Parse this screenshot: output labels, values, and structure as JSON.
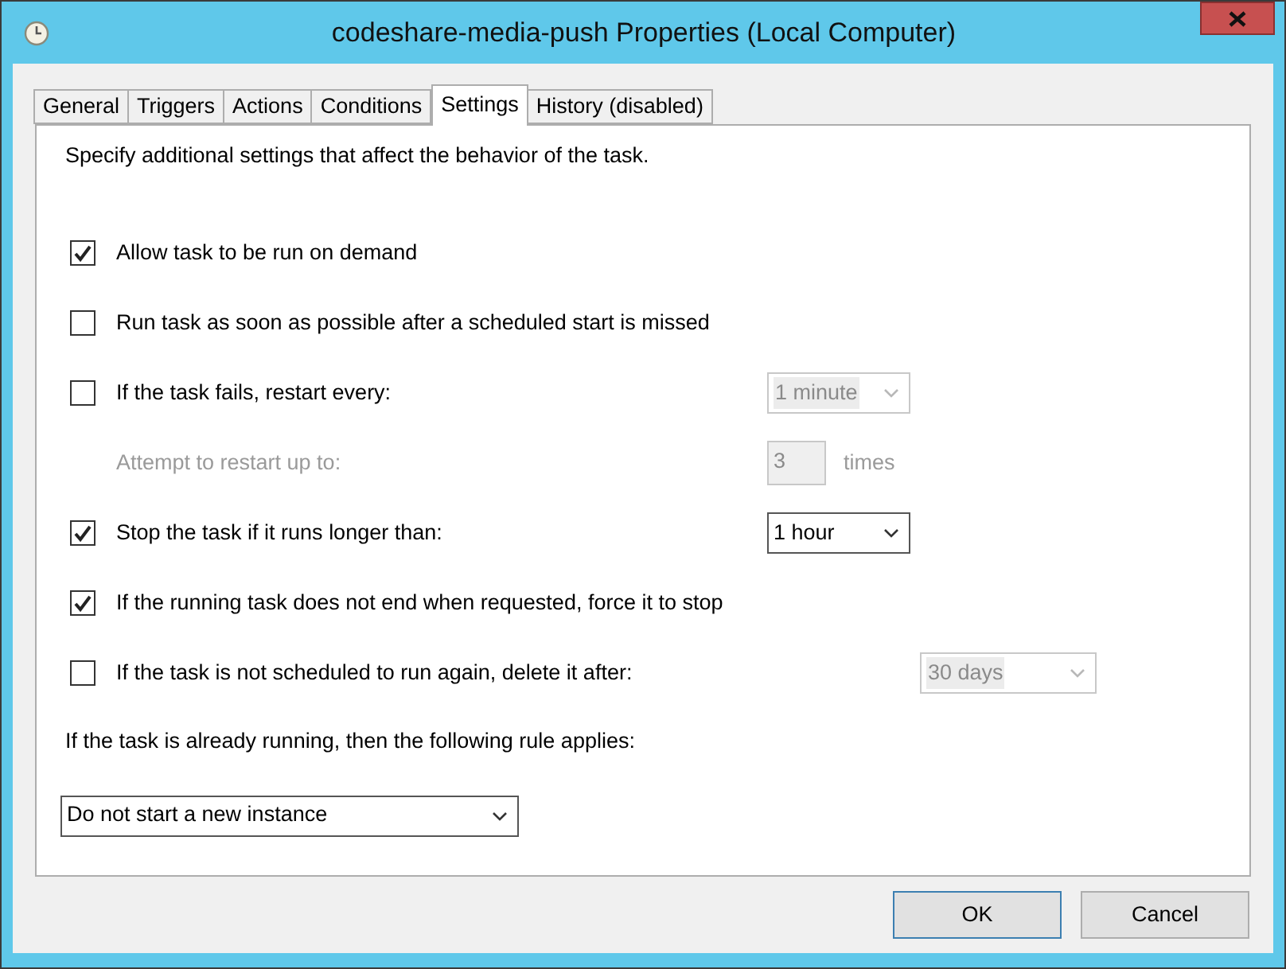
{
  "window": {
    "title": "codeshare-media-push Properties (Local Computer)"
  },
  "tabs": [
    {
      "label": "General",
      "selected": false
    },
    {
      "label": "Triggers",
      "selected": false
    },
    {
      "label": "Actions",
      "selected": false
    },
    {
      "label": "Conditions",
      "selected": false
    },
    {
      "label": "Settings",
      "selected": true
    },
    {
      "label": "History (disabled)",
      "selected": false
    }
  ],
  "intro": "Specify additional settings that affect the behavior of the task.",
  "settings": [
    {
      "kind": "checkbox",
      "label": "Allow task to be run on demand",
      "checked": true
    },
    {
      "kind": "checkbox",
      "label": "Run task as soon as possible after a scheduled start is missed",
      "checked": false
    },
    {
      "kind": "checkbox",
      "label": "If the task fails, restart every:",
      "checked": false,
      "dropdown": {
        "value": "1 minute",
        "disabled": true
      }
    },
    {
      "kind": "spin",
      "label": "Attempt to restart up to:",
      "disabled": true,
      "value": "3",
      "unit": "times"
    },
    {
      "kind": "checkbox",
      "label": "Stop the task if it runs longer than:",
      "checked": true,
      "dropdown": {
        "value": "1 hour",
        "disabled": false
      }
    },
    {
      "kind": "checkbox",
      "label": "If the running task does not end when requested, force it to stop",
      "checked": true
    },
    {
      "kind": "checkbox",
      "label": "If the task is not scheduled to run again, delete it after:",
      "checked": false,
      "dropdown": {
        "value": "30 days",
        "disabled": true
      }
    }
  ],
  "rule_label": "If the task is already running, then the following rule applies:",
  "rule_dropdown": {
    "value": "Do not start a new instance",
    "disabled": false
  },
  "buttons": [
    {
      "label": "OK",
      "default": true
    },
    {
      "label": "Cancel",
      "default": false
    }
  ]
}
